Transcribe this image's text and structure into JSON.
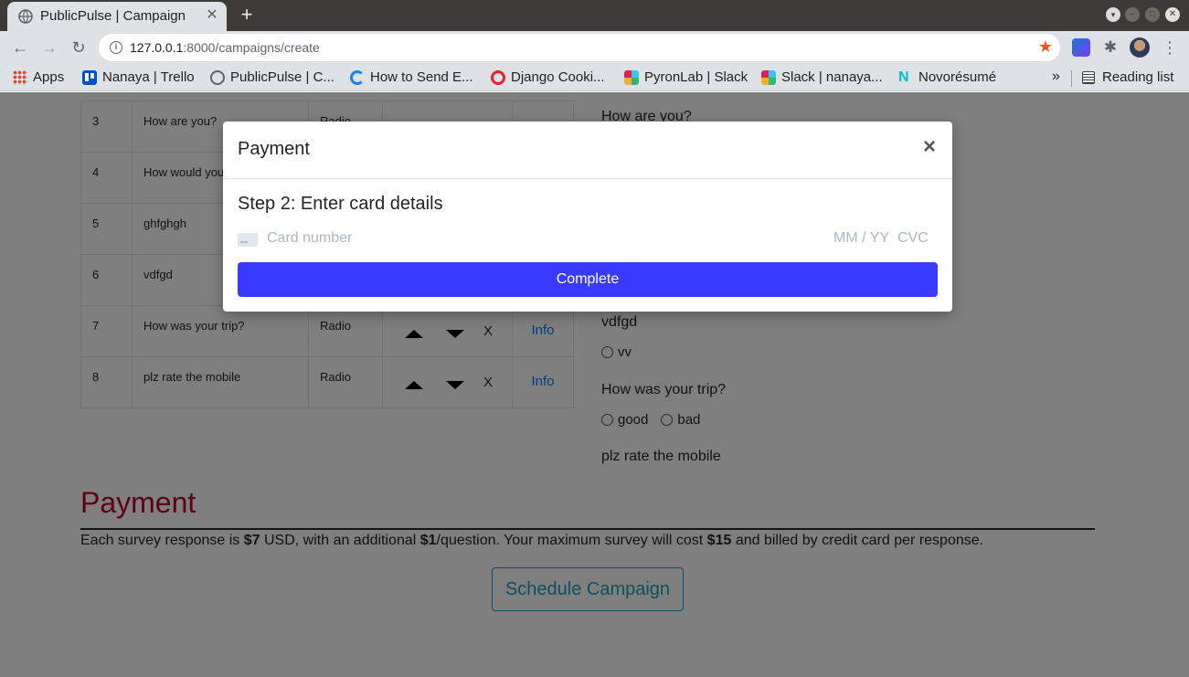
{
  "browser": {
    "tab_title": "PublicPulse | Campaign",
    "url_host": "127.0.0.1",
    "url_rest": ":8000/campaigns/create",
    "bookmarks": [
      {
        "label": "Apps",
        "icon": "apps-icon"
      },
      {
        "label": "Nanaya | Trello",
        "icon": "trello-icon"
      },
      {
        "label": "PublicPulse | C...",
        "icon": "globe-icon"
      },
      {
        "label": "How to Send E...",
        "icon": "sendgrid-icon"
      },
      {
        "label": "Django Cooki...",
        "icon": "django-icon"
      },
      {
        "label": "PyronLab | Slack",
        "icon": "slack-icon"
      },
      {
        "label": "Slack | nanaya...",
        "icon": "slack-icon"
      },
      {
        "label": "Novorésumé",
        "icon": "novoresume-icon"
      }
    ],
    "more_label": "»",
    "reading_list": "Reading list"
  },
  "questions": [
    {
      "num": "3",
      "text": "How are you?",
      "type": "Radio"
    },
    {
      "num": "4",
      "text": "How would you experience ?",
      "type": ""
    },
    {
      "num": "5",
      "text": "ghfghgh",
      "type": ""
    },
    {
      "num": "6",
      "text": "vdfgd",
      "type": ""
    },
    {
      "num": "7",
      "text": "How was your trip?",
      "type": "Radio",
      "delete": "X",
      "info": "Info"
    },
    {
      "num": "8",
      "text": "plz rate the mobile",
      "type": "Radio",
      "delete": "X",
      "info": "Info"
    }
  ],
  "preview": {
    "q1": "How are you?",
    "q2": "vdfgd",
    "q2_opt": "vv",
    "q3": "How was your trip?",
    "q3_opts": [
      "good",
      "bad"
    ],
    "q4": "plz rate the mobile"
  },
  "payment": {
    "title": "Payment",
    "text_1": "Each survey response is ",
    "price_response": "$7",
    "text_2": " USD, with an additional ",
    "price_question": "$1",
    "text_3": "/question. Your maximum survey will cost ",
    "price_max": "$15",
    "text_4": " and billed by credit card per response.",
    "schedule_button": "Schedule Campaign"
  },
  "modal": {
    "title": "Payment",
    "close": "×",
    "step": "Step 2: Enter card details",
    "card_placeholder": "Card number",
    "exp_placeholder": "MM / YY",
    "cvc_placeholder": "CVC",
    "complete_button": "Complete"
  },
  "colors": {
    "accent": "#3a3afc",
    "payment_title": "#c0002e",
    "schedule": "#17a2b8",
    "link": "#007bff"
  }
}
